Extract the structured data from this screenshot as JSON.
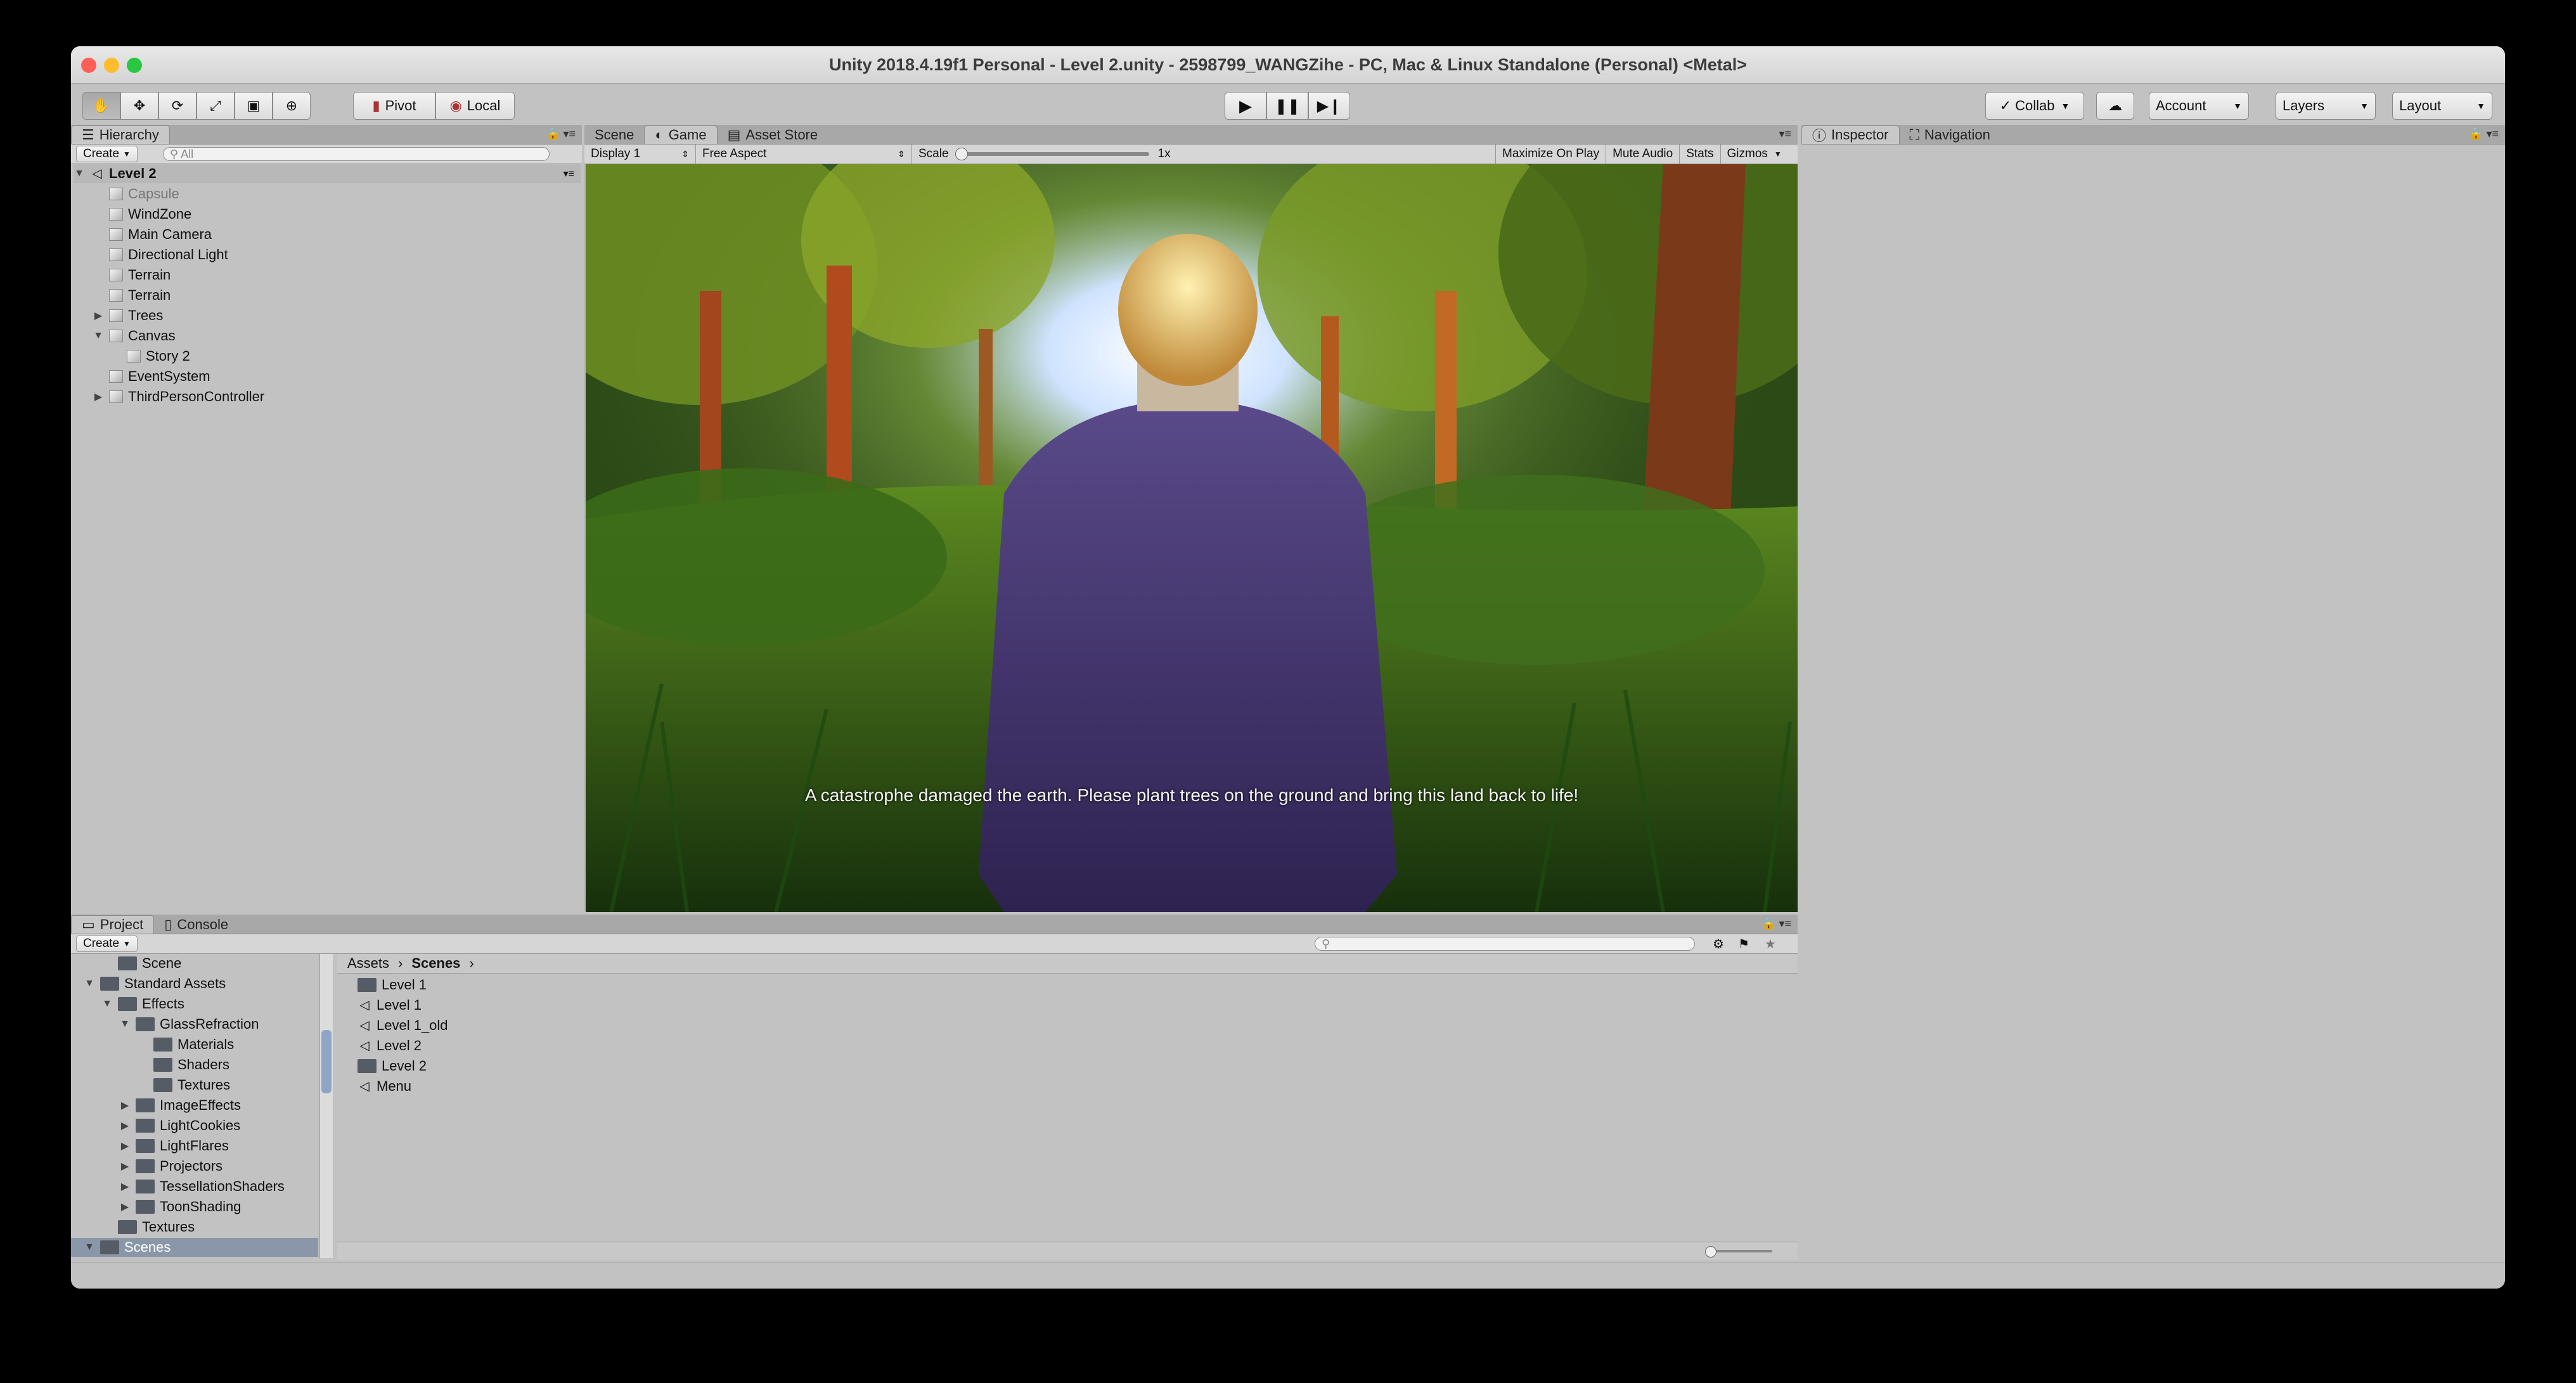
{
  "window": {
    "title": "Unity 2018.4.19f1 Personal - Level 2.unity - 2598799_WANGZihe - PC, Mac & Linux Standalone (Personal) <Metal>"
  },
  "toolbar": {
    "pivot_label": "Pivot",
    "local_label": "Local",
    "collab_label": "Collab",
    "account_label": "Account",
    "layers_label": "Layers",
    "layout_label": "Layout"
  },
  "hierarchy": {
    "tab_label": "Hierarchy",
    "create_label": "Create",
    "search_placeholder": "All",
    "scene_name": "Level 2",
    "items": [
      {
        "label": "Capsule",
        "indent": 0,
        "arrow": ""
      },
      {
        "label": "WindZone",
        "indent": 0,
        "arrow": ""
      },
      {
        "label": "Main Camera",
        "indent": 0,
        "arrow": ""
      },
      {
        "label": "Directional Light",
        "indent": 0,
        "arrow": ""
      },
      {
        "label": "Terrain",
        "indent": 0,
        "arrow": ""
      },
      {
        "label": "Terrain",
        "indent": 0,
        "arrow": ""
      },
      {
        "label": "Trees",
        "indent": 0,
        "arrow": "▶"
      },
      {
        "label": "Canvas",
        "indent": 0,
        "arrow": "▼"
      },
      {
        "label": "Story 2",
        "indent": 1,
        "arrow": ""
      },
      {
        "label": "EventSystem",
        "indent": 0,
        "arrow": ""
      },
      {
        "label": "ThirdPersonController",
        "indent": 0,
        "arrow": "▶"
      }
    ]
  },
  "center_tabs": {
    "scene": "Scene",
    "game": "Game",
    "asset_store": "Asset Store"
  },
  "game_toolbar": {
    "display": "Display 1",
    "aspect": "Free Aspect",
    "scale_label": "Scale",
    "scale_value": "1x",
    "maximize_on_play": "Maximize On Play",
    "mute_audio": "Mute Audio",
    "stats": "Stats",
    "gizmos": "Gizmos"
  },
  "game_view": {
    "caption": "A catastrophe damaged the earth. Please plant trees on the ground and bring this land back to life!"
  },
  "right_tabs": {
    "inspector": "Inspector",
    "navigation": "Navigation"
  },
  "project": {
    "tab_project": "Project",
    "tab_console": "Console",
    "create_label": "Create",
    "tree": [
      {
        "label": "Scene",
        "level": 2,
        "arrow": ""
      },
      {
        "label": "Standard Assets",
        "level": 1,
        "arrow": "▼"
      },
      {
        "label": "Effects",
        "level": 2,
        "arrow": "▼"
      },
      {
        "label": "GlassRefraction",
        "level": 3,
        "arrow": "▼"
      },
      {
        "label": "Materials",
        "level": 4,
        "arrow": ""
      },
      {
        "label": "Shaders",
        "level": 4,
        "arrow": ""
      },
      {
        "label": "Textures",
        "level": 4,
        "arrow": ""
      },
      {
        "label": "ImageEffects",
        "level": 3,
        "arrow": "▶"
      },
      {
        "label": "LightCookies",
        "level": 3,
        "arrow": "▶"
      },
      {
        "label": "LightFlares",
        "level": 3,
        "arrow": "▶"
      },
      {
        "label": "Projectors",
        "level": 3,
        "arrow": "▶"
      },
      {
        "label": "TessellationShaders",
        "level": 3,
        "arrow": "▶"
      },
      {
        "label": "ToonShading",
        "level": 3,
        "arrow": "▶"
      },
      {
        "label": "Textures",
        "level": 2,
        "arrow": ""
      },
      {
        "label": "Scenes",
        "level": 1,
        "arrow": "▼"
      }
    ],
    "breadcrumb_root": "Assets",
    "breadcrumb_current": "Scenes",
    "files": [
      {
        "label": "Level 1",
        "type": "folder"
      },
      {
        "label": "Level 1",
        "type": "scene"
      },
      {
        "label": "Level 1_old",
        "type": "scene"
      },
      {
        "label": "Level 2",
        "type": "scene"
      },
      {
        "label": "Level 2",
        "type": "folder"
      },
      {
        "label": "Menu",
        "type": "scene"
      }
    ]
  }
}
